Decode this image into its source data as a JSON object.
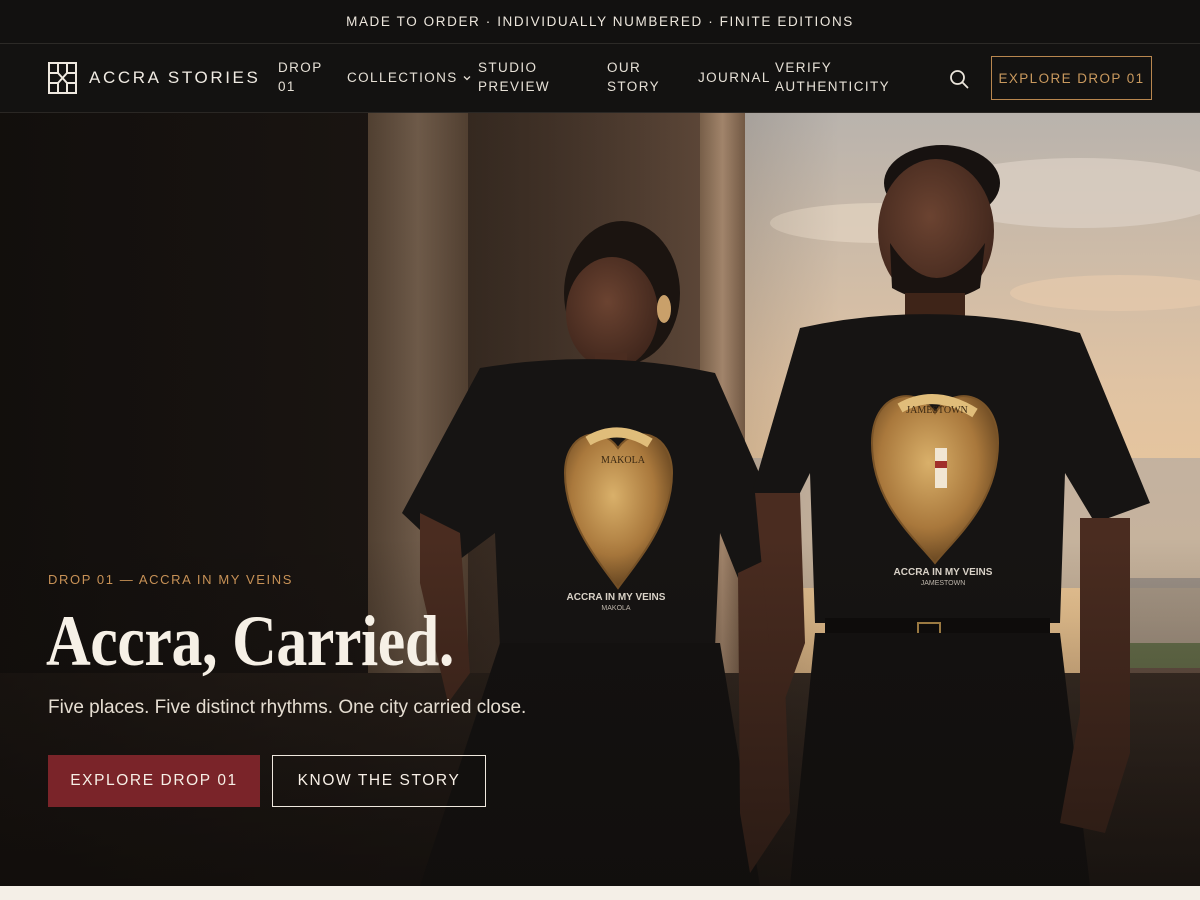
{
  "announcement": "MADE TO ORDER · INDIVIDUALLY NUMBERED · FINITE EDITIONS",
  "brand": {
    "name": "ACCRA STORIES",
    "logo_icon": "accra-stories-logo-icon"
  },
  "nav": {
    "items": [
      {
        "label_line1": "DROP",
        "label_line2": "01"
      },
      {
        "label": "COLLECTIONS",
        "has_dropdown": true
      },
      {
        "label_line1": "STUDIO",
        "label_line2": "PREVIEW"
      },
      {
        "label_line1": "OUR",
        "label_line2": "STORY"
      },
      {
        "label": "JOURNAL"
      },
      {
        "label_line1": "VERIFY",
        "label_line2": "AUTHENTICITY"
      }
    ],
    "search_icon": "search-icon",
    "cta": "EXPLORE DROP 01"
  },
  "hero": {
    "eyebrow": "DROP 01 — ACCRA IN MY VEINS",
    "headline": "Accra, Carried.",
    "subhead": "Five places. Five distinct rhythms. One city carried close.",
    "primary_cta": "EXPLORE DROP 01",
    "secondary_cta": "KNOW THE STORY",
    "shirt_left": {
      "banner": "MAKOLA",
      "line1": "ACCRA IN MY VEINS",
      "line2": "MAKOLA"
    },
    "shirt_right": {
      "banner": "JAMESTOWN",
      "line1": "ACCRA IN MY VEINS",
      "line2": "JAMESTOWN"
    }
  },
  "colors": {
    "bar": "#121110",
    "accent_gold": "#c79156",
    "primary_button": "#7a2429",
    "text_light": "#f6f0e6"
  }
}
